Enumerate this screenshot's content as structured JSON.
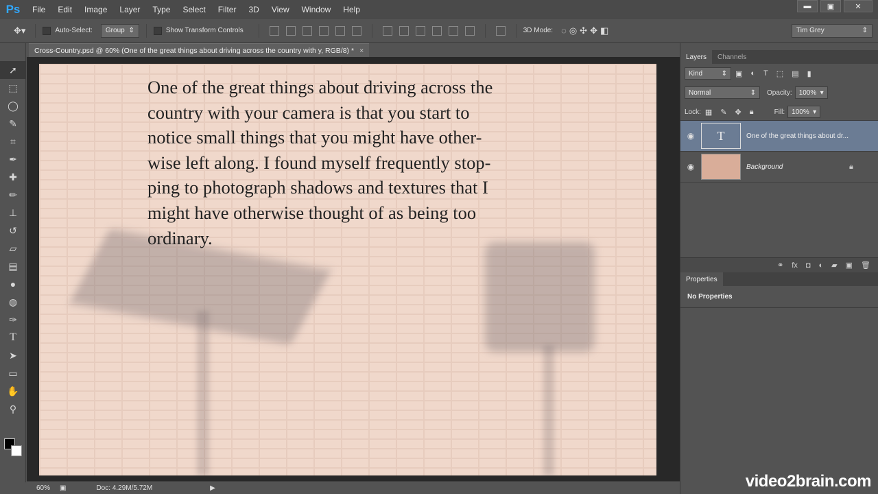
{
  "app": {
    "logo": "Ps"
  },
  "menu": [
    "File",
    "Edit",
    "Image",
    "Layer",
    "Type",
    "Select",
    "Filter",
    "3D",
    "View",
    "Window",
    "Help"
  ],
  "window_controls": [
    "▬",
    "▣",
    "✕"
  ],
  "options_bar": {
    "auto_select_label": "Auto-Select:",
    "auto_select_value": "Group",
    "show_transform_label": "Show Transform Controls",
    "mode_3d_label": "3D Mode:",
    "workspace": "Tim Grey"
  },
  "document": {
    "tab_title": "Cross-Country.psd @ 60% (One of the great things about driving across the country with y, RGB/8) *",
    "text_lines": [
      "One of the great things about driving across the",
      "country with your camera is that you start to",
      "notice small things that you might have other-",
      "wise left along. I found myself frequently stop-",
      "ping to photograph shadows and textures that I",
      "might have otherwise thought of as being too",
      "ordinary."
    ]
  },
  "status": {
    "zoom": "60%",
    "doc": "Doc: 4.29M/5.72M"
  },
  "layers_panel": {
    "tabs": [
      "Layers",
      "Channels"
    ],
    "filter_label": "Kind",
    "blend_mode": "Normal",
    "opacity_label": "Opacity:",
    "opacity_value": "100%",
    "lock_label": "Lock:",
    "fill_label": "Fill:",
    "fill_value": "100%",
    "layers": [
      {
        "name": "One of the great things about dr...",
        "type": "text",
        "selected": true
      },
      {
        "name": "Background",
        "type": "image",
        "selected": false
      }
    ]
  },
  "properties_panel": {
    "tab": "Properties",
    "body": "No Properties"
  },
  "watermark": "video2brain.com",
  "colors": {
    "accent": "#31a8ff",
    "selected_layer": "#6b7c94",
    "ui_bg": "#535353"
  }
}
